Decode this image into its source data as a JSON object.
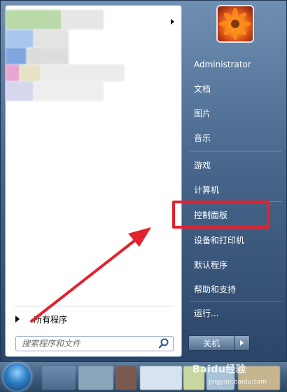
{
  "menu": {
    "all_programs": "所有程序",
    "search_placeholder": "搜索程序和文件"
  },
  "user": {
    "name": "Administrator"
  },
  "right_items": [
    {
      "label": "Administrator"
    },
    {
      "label": "文档"
    },
    {
      "label": "图片"
    },
    {
      "label": "音乐"
    },
    {
      "label": "游戏"
    },
    {
      "label": "计算机"
    },
    {
      "label": "控制面板"
    },
    {
      "label": "设备和打印机"
    },
    {
      "label": "默认程序"
    },
    {
      "label": "帮助和支持"
    },
    {
      "label": "运行..."
    }
  ],
  "shutdown": {
    "label": "关机"
  },
  "watermark": {
    "brand": "Baidu经验",
    "url": "jingyan.baidu.com"
  },
  "colors": {
    "highlight": "#e2222d",
    "arrow": "#e2222d"
  }
}
